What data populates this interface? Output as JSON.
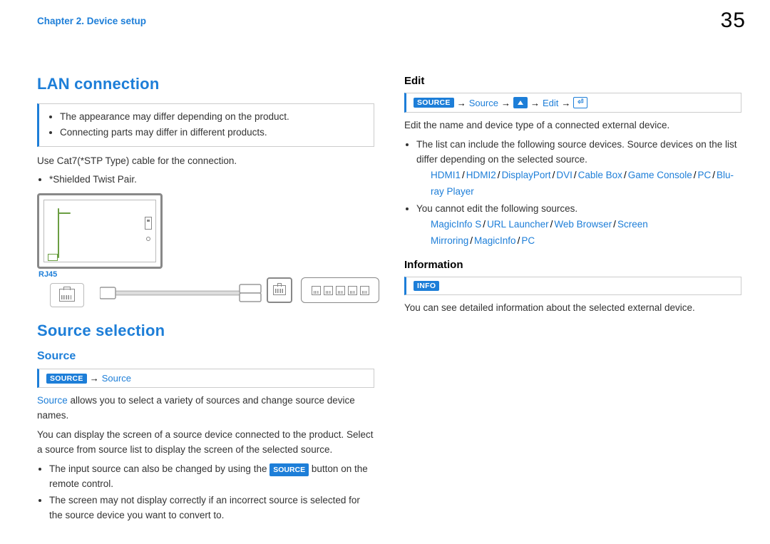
{
  "page_number": "35",
  "chapter": "Chapter 2. Device setup",
  "left": {
    "h_lan": "LAN connection",
    "note_items": [
      "The appearance may differ depending on the product.",
      "Connecting parts may differ in different products."
    ],
    "cable_note": "Use Cat7(*STP Type) cable for the connection.",
    "stp_note": "*Shielded Twist Pair.",
    "rj45_label": "RJ45",
    "h_source_selection": "Source selection",
    "h_source": "Source",
    "path_source_badge": "SOURCE",
    "path_source_step": "Source",
    "src_para_lead": "Source",
    "src_para_rest": " allows you to select a variety of sources and change source device names.",
    "src_para2": "You can display the screen of a source device connected to the product. Select a source from source list to display the screen of the selected source.",
    "src_bullets": [
      {
        "pre": "The input source can also be changed by using the ",
        "badge": "SOURCE",
        "post": " button on the remote control."
      },
      {
        "text": "The screen may not display correctly if an incorrect source is selected for the source device you want to convert to."
      }
    ]
  },
  "right": {
    "h_edit": "Edit",
    "edit_path": {
      "badge": "SOURCE",
      "step_source": "Source",
      "step_edit": "Edit"
    },
    "edit_intro": "Edit the name and device type of a connected external device.",
    "edit_b1": "The list can include the following source devices. Source devices on the list differ depending on the selected source.",
    "edit_sources1": [
      "HDMI1",
      "HDMI2",
      "DisplayPort",
      "DVI",
      "Cable Box",
      "Game Console",
      "PC",
      "Blu-ray Player"
    ],
    "edit_b2": "You cannot edit the following sources.",
    "edit_sources2": [
      "MagicInfo S",
      "URL Launcher",
      "Web Browser",
      "Screen Mirroring",
      "MagicInfo",
      "PC"
    ],
    "h_info": "Information",
    "info_badge": "INFO",
    "info_text": "You can see detailed information about the selected external device."
  }
}
